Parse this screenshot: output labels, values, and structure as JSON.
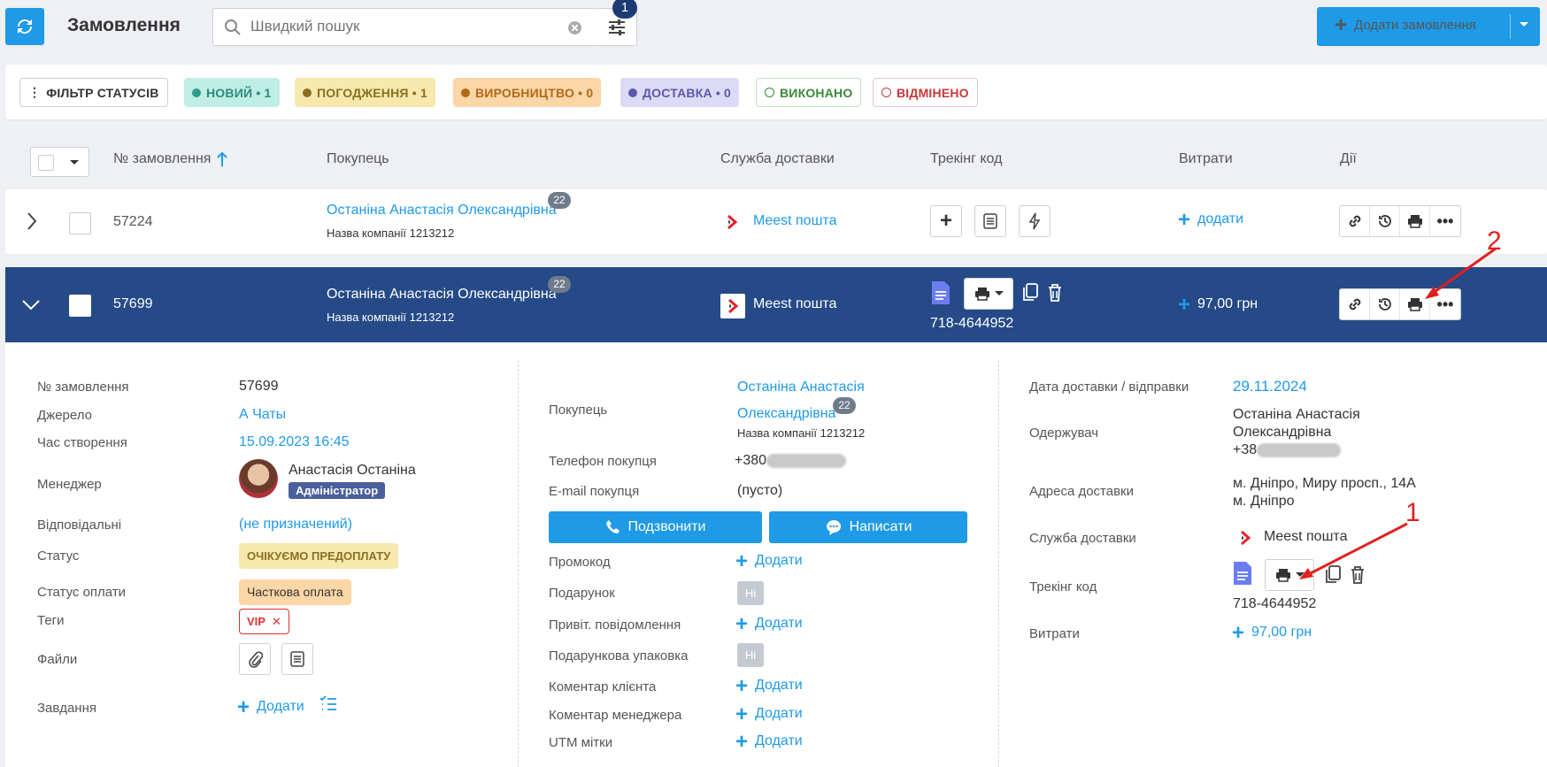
{
  "header": {
    "title": "Замовлення",
    "search_placeholder": "Швидкий пошук",
    "filter_count": "1",
    "add_order_label": "Додати замовлення"
  },
  "status_filter": {
    "label": "ФІЛЬТР СТАТУСІВ",
    "chips": [
      {
        "label": "НОВИЙ • 1",
        "color": "#2e9c8a"
      },
      {
        "label": "ПОГОДЖЕННЯ • 1",
        "color": "#8a7020"
      },
      {
        "label": "ВИРОБНИЦТВО • 0",
        "color": "#b06a1a"
      },
      {
        "label": "ДОСТАВКА • 0",
        "color": "#5c5aa8"
      },
      {
        "label": "ВИКОНАНО",
        "color": "#3a8a3a"
      },
      {
        "label": "ВІДМІНЕНО",
        "color": "#c83838"
      }
    ]
  },
  "table": {
    "columns": {
      "order_no": "№ замовлення",
      "customer": "Покупець",
      "delivery": "Служба доставки",
      "tracking": "Трекінг код",
      "costs": "Витрати",
      "actions": "Дії"
    },
    "rows": [
      {
        "order_no": "57224",
        "customer": "Останіна Анастасія Олександрівна",
        "company": "Назва компанії 1213212",
        "badge": "22",
        "delivery": "Meest пошта",
        "costs": "додати"
      },
      {
        "order_no": "57699",
        "customer": "Останіна Анастасія Олександрівна",
        "company": "Назва компанії 1213212",
        "badge": "22",
        "delivery": "Meest пошта",
        "tracking": "718-4644952",
        "costs": "97,00 грн"
      }
    ]
  },
  "details": {
    "col1": {
      "order_no_label": "№ замовлення",
      "order_no": "57699",
      "source_label": "Джерело",
      "source": "А Чаты",
      "created_label": "Час створення",
      "created": "15.09.2023 16:45",
      "manager_label": "Менеджер",
      "manager_name": "Анастасія Останіна",
      "manager_role": "Адміністратор",
      "responsible_label": "Відповідальні",
      "responsible": "(не призначений)",
      "status_label": "Статус",
      "status": "ОЧІКУЄМО ПРЕДОПЛАТУ",
      "payment_label": "Статус оплати",
      "payment": "Часткова оплата",
      "tags_label": "Теги",
      "tag": "VIP",
      "files_label": "Файли",
      "tasks_label": "Завдання",
      "tasks_add": "Додати"
    },
    "col2": {
      "customer_label": "Покупець",
      "customer_line1": "Останіна Анастасія",
      "customer_line2": "Олександрівна",
      "customer_badge": "22",
      "company": "Назва компанії 1213212",
      "phone_label": "Телефон покупця",
      "phone_prefix": "+380",
      "email_label": "E-mail покупця",
      "email": "(пусто)",
      "call_btn": "Подзвонити",
      "write_btn": "Написати",
      "promo_label": "Промокод",
      "gift_label": "Подарунок",
      "greeting_label": "Привіт. повідомлення",
      "gift_wrap_label": "Подарункова упаковка",
      "client_comment_label": "Коментар клієнта",
      "manager_comment_label": "Коментар менеджера",
      "utm_label": "UTM мітки",
      "add": "Додати",
      "no": "Ні"
    },
    "col3": {
      "delivery_date_label": "Дата доставки / відправки",
      "delivery_date": "29.11.2024",
      "recipient_label": "Одержувач",
      "recipient_line1": "Останіна Анастасія",
      "recipient_line2": "Олександрівна",
      "recipient_phone_prefix": "+38",
      "address_label": "Адреса доставки",
      "address_line1": "м. Дніпро, Миру просп., 14А",
      "address_line2": "м. Дніпро",
      "service_label": "Служба доставки",
      "service": "Meest пошта",
      "tracking_label": "Трекінг код",
      "tracking": "718-4644952",
      "costs_label": "Витрати",
      "costs": "97,00 грн"
    }
  },
  "annotations": {
    "one": "1",
    "two": "2"
  }
}
